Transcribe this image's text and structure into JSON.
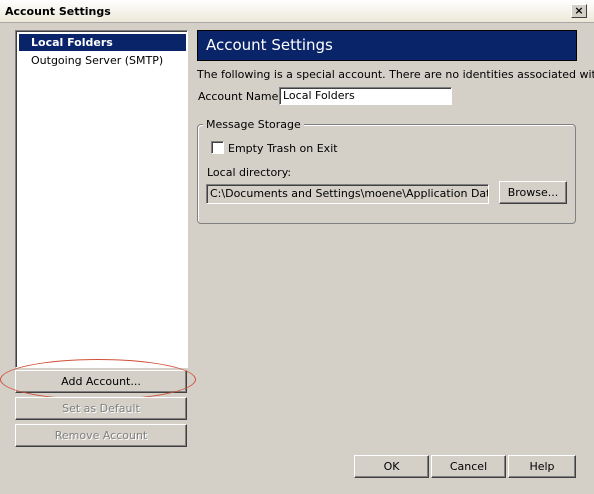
{
  "window": {
    "title": "Account Settings",
    "close_label": "×"
  },
  "sidebar": {
    "items": [
      {
        "label": "Local Folders"
      },
      {
        "label": "Outgoing Server (SMTP)"
      }
    ],
    "buttons": {
      "add_account": "Add Account...",
      "set_default": "Set as Default",
      "remove_account": "Remove Account"
    }
  },
  "main": {
    "header": "Account Settings",
    "description": "The following is a special account. There are no identities associated with it.",
    "account_name_label": "Account Name:",
    "account_name_value": "Local Folders",
    "message_storage": {
      "legend": "Message Storage",
      "empty_trash_label": "Empty Trash on Exit",
      "empty_trash_checked": false,
      "local_directory_label": "Local directory:",
      "local_directory_value": "C:\\Documents and Settings\\moene\\Application Data\\Thunderbird",
      "browse_label": "Browse..."
    }
  },
  "footer": {
    "ok": "OK",
    "cancel": "Cancel",
    "help": "Help"
  },
  "colors": {
    "selection": "#0a246a",
    "window_bg": "#d4d0c8",
    "annotation_oval": "#d0513a"
  }
}
